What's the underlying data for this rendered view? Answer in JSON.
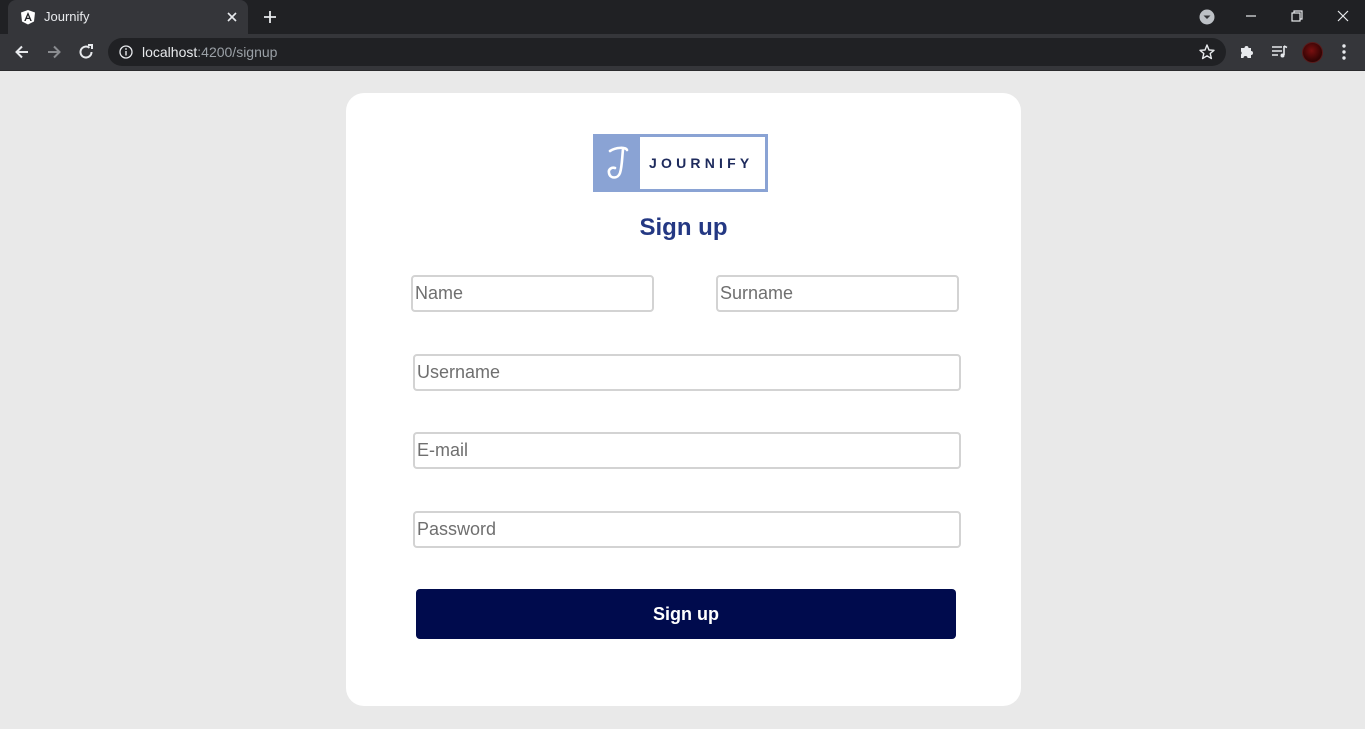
{
  "browser": {
    "tab_title": "Journify",
    "url_host": "localhost",
    "url_path": ":4200/signup"
  },
  "page": {
    "logo_text": "JOURNIFY",
    "heading": "Sign up",
    "fields": {
      "name_placeholder": "Name",
      "surname_placeholder": "Surname",
      "username_placeholder": "Username",
      "email_placeholder": "E-mail",
      "password_placeholder": "Password"
    },
    "submit_label": "Sign up"
  },
  "colors": {
    "page_background": "#e9e9e9",
    "heading": "#243883",
    "button": "#000b4d",
    "logo_accent": "#8aa3d4"
  },
  "icons": [
    "angular-favicon-icon",
    "close-icon",
    "plus-icon",
    "tab-search-icon",
    "minimize-icon",
    "restore-icon",
    "window-close-icon",
    "back-arrow-icon",
    "forward-arrow-icon",
    "reload-icon",
    "info-icon",
    "star-icon",
    "extensions-icon",
    "media-control-icon",
    "kebab-menu-icon"
  ]
}
